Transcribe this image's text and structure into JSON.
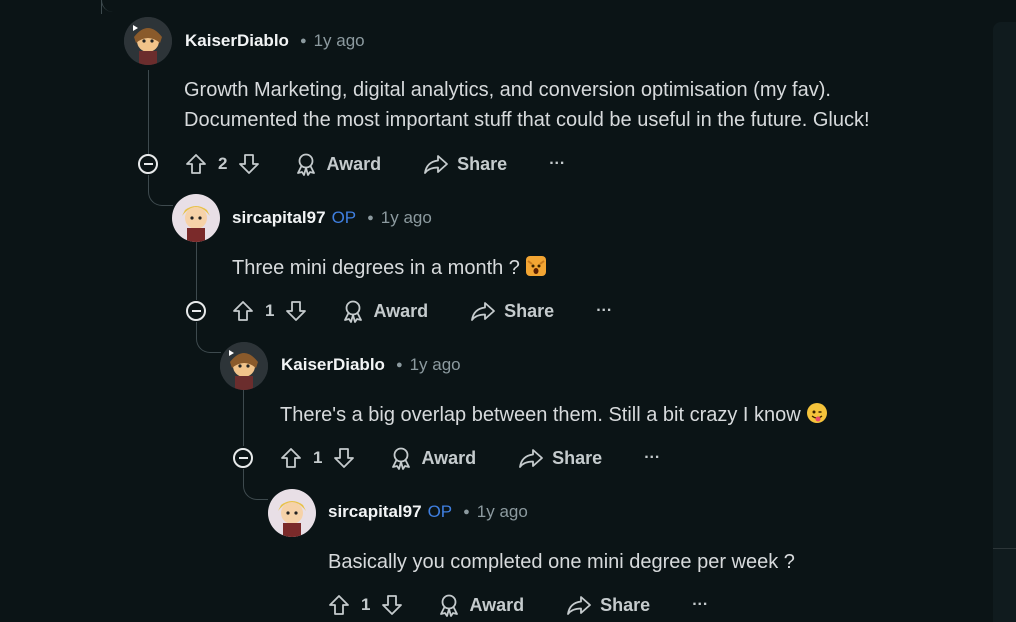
{
  "comments": [
    {
      "author": "KaiserDiablo",
      "op": "",
      "time": "1y ago",
      "lines": [
        "Growth Marketing, digital analytics, and conversion optimisation (my fav).",
        "Documented the most important stuff that could be useful in the future. Gluck!"
      ],
      "score": "2",
      "award_label": "Award",
      "share_label": "Share",
      "more_label": "···"
    },
    {
      "author": "sircapital97",
      "op": "OP",
      "time": "1y ago",
      "lines": [
        "Three mini degrees in a month ?"
      ],
      "emoji": "cat-scream-emoji",
      "score": "1",
      "award_label": "Award",
      "share_label": "Share",
      "more_label": "···"
    },
    {
      "author": "KaiserDiablo",
      "op": "",
      "time": "1y ago",
      "lines": [
        "There's a big overlap between them. Still a bit crazy I know"
      ],
      "emoji": "tongue-wink-emoji",
      "score": "1",
      "award_label": "Award",
      "share_label": "Share",
      "more_label": "···"
    },
    {
      "author": "sircapital97",
      "op": "OP",
      "time": "1y ago",
      "lines": [
        "Basically you completed one mini degree per week ?"
      ],
      "score": "1",
      "award_label": "Award",
      "share_label": "Share",
      "more_label": "···"
    }
  ],
  "colors": {
    "background": "#0b1416",
    "op_accent": "#3f7fe0",
    "thread_line": "#3e4a4e"
  }
}
